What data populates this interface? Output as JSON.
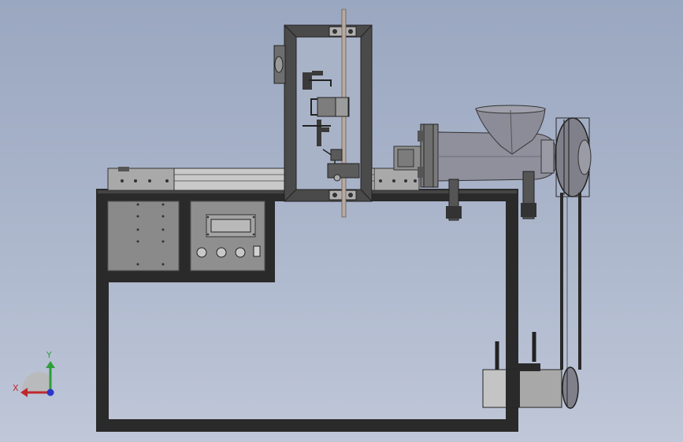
{
  "view": {
    "background_top": "#9aa7c0",
    "background_bottom": "#bfc7d8"
  },
  "model": {
    "frame_color": "#2a2a2a",
    "panel_color": "#8a8a8a",
    "steel_color": "#9c9c9c",
    "barrel_color": "#8f909c",
    "display_color": "#b9b9b9"
  },
  "triad": {
    "x_label": "X",
    "y_label": "Y",
    "x_color": "#c0282d",
    "y_color": "#2e9e3a",
    "z_color": "#2a36c7"
  }
}
